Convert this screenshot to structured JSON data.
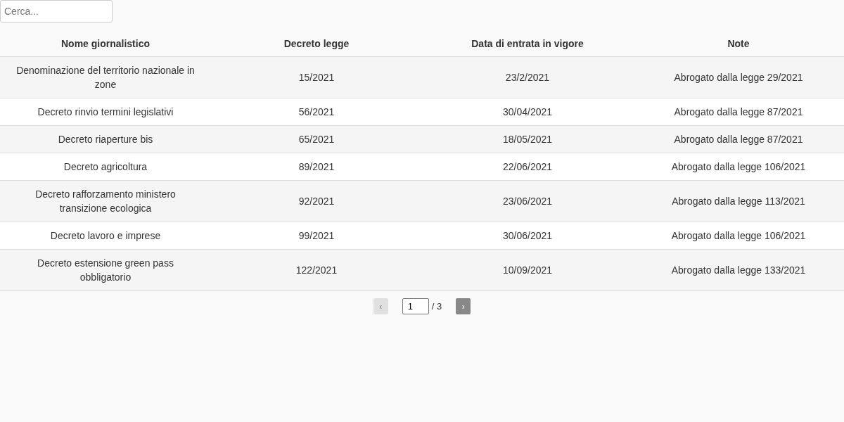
{
  "search": {
    "placeholder": "Cerca..."
  },
  "table": {
    "columns": [
      "Nome giornalistico",
      "Decreto legge",
      "Data di entrata in vigore",
      "Note"
    ],
    "rows": [
      [
        "Denominazione del territorio nazionale in zone",
        "15/2021",
        "23/2/2021",
        "Abrogato dalla legge 29/2021"
      ],
      [
        "Decreto rinvio termini legislativi",
        "56/2021",
        "30/04/2021",
        "Abrogato dalla legge 87/2021"
      ],
      [
        "Decreto riaperture bis",
        "65/2021",
        "18/05/2021",
        "Abrogato dalla legge 87/2021"
      ],
      [
        "Decreto agricoltura",
        "89/2021",
        "22/06/2021",
        "Abrogato dalla legge 106/2021"
      ],
      [
        "Decreto rafforzamento ministero transizione ecologica",
        "92/2021",
        "23/06/2021",
        "Abrogato dalla legge 113/2021"
      ],
      [
        "Decreto lavoro e imprese",
        "99/2021",
        "30/06/2021",
        "Abrogato dalla legge 106/2021"
      ],
      [
        "Decreto estensione green pass obbligatorio",
        "122/2021",
        "10/09/2021",
        "Abrogato dalla legge 133/2021"
      ]
    ]
  },
  "pagination": {
    "prev": {
      "label": "‹",
      "disabled": true
    },
    "page": "1",
    "total": "/ 3",
    "next": {
      "label": "›",
      "disabled": false
    }
  }
}
